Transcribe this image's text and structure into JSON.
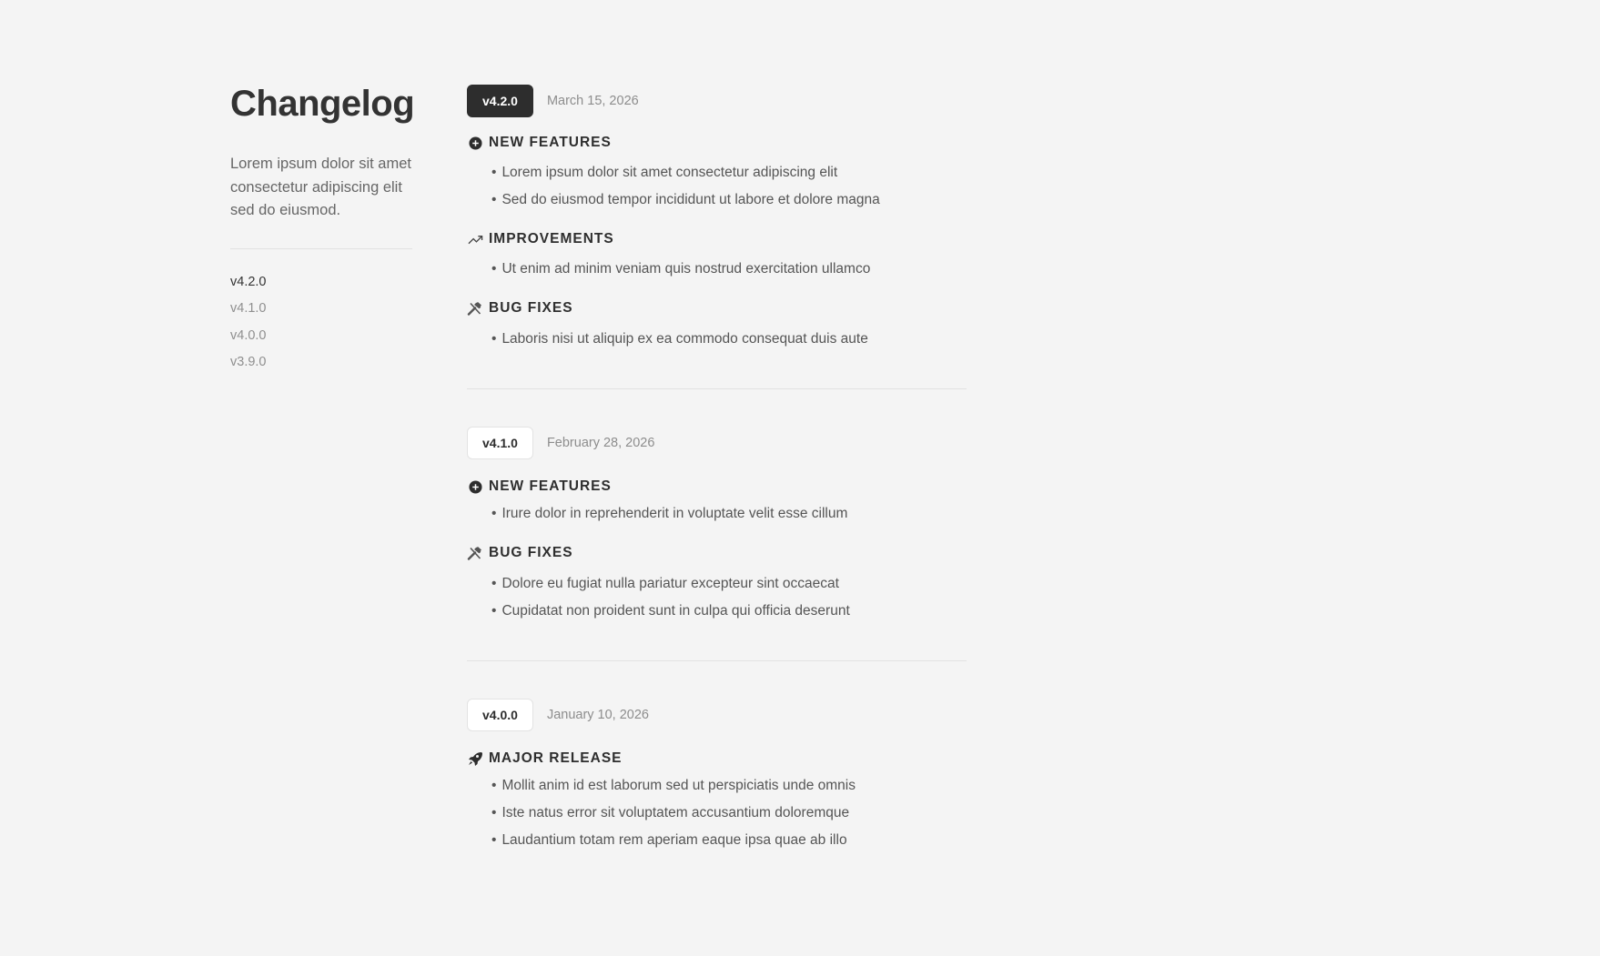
{
  "sidebar": {
    "title": "Changelog",
    "description": "Lorem ipsum dolor sit amet consectetur adipiscing elit sed do eiusmod.",
    "versions": [
      "v4.2.0",
      "v4.1.0",
      "v4.0.0",
      "v3.9.0"
    ],
    "active_version": "v4.2.0"
  },
  "releases": [
    {
      "version": "v4.2.0",
      "date": "March 15, 2026",
      "sections": [
        {
          "title": "NEW FEATURES",
          "icon": "plus-circle-icon",
          "items": [
            "Lorem ipsum dolor sit amet consectetur adipiscing elit",
            "Sed do eiusmod tempor incididunt ut labore et dolore magna"
          ]
        },
        {
          "title": "IMPROVEMENTS",
          "icon": "trending-up-icon",
          "items": [
            "Ut enim ad minim veniam quis nostrud exercitation ullamco"
          ]
        },
        {
          "title": "BUG FIXES",
          "icon": "tools-icon",
          "items": [
            "Laboris nisi ut aliquip ex ea commodo consequat duis aute"
          ]
        }
      ]
    },
    {
      "version": "v4.1.0",
      "date": "February 28, 2026",
      "sections": [
        {
          "title": "NEW FEATURES",
          "icon": "plus-circle-icon",
          "items": [
            "Irure dolor in reprehenderit in voluptate velit esse cillum"
          ]
        },
        {
          "title": "BUG FIXES",
          "icon": "tools-icon",
          "items": [
            "Dolore eu fugiat nulla pariatur excepteur sint occaecat",
            "Cupidatat non proident sunt in culpa qui officia deserunt"
          ]
        }
      ]
    },
    {
      "version": "v4.0.0",
      "date": "January 10, 2026",
      "sections": [
        {
          "title": "MAJOR RELEASE",
          "icon": "rocket-icon",
          "items": [
            "Mollit anim id est laborum sed ut perspiciatis unde omnis",
            "Iste natus error sit voluptatem accusantium doloremque",
            "Laudantium totam rem aperiam eaque ipsa quae ab illo"
          ]
        }
      ]
    }
  ],
  "colors": {
    "background": "#f4f4f4",
    "accent_dark": "#2d2d2d",
    "muted_text": "#8d8d8d"
  }
}
